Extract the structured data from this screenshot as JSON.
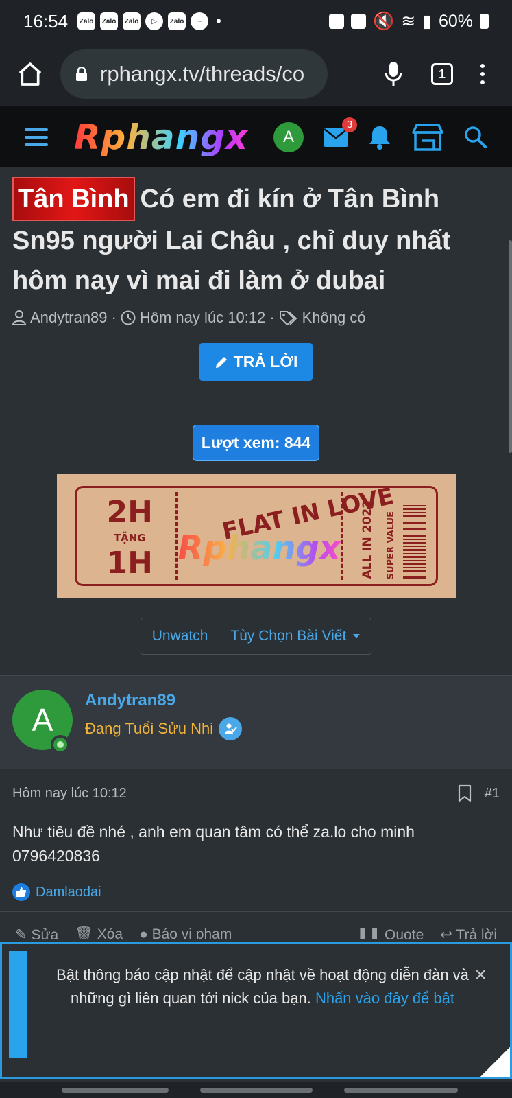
{
  "status_bar": {
    "time": "16:54",
    "notif_icons": [
      "Zalo",
      "Zalo",
      "Zalo",
      "",
      "Zalo",
      ""
    ],
    "battery": "60%"
  },
  "browser": {
    "url": "rphangx.tv/threads/co",
    "tab_count": "1"
  },
  "site_nav": {
    "logo": "Rphangx",
    "avatar_letter": "A",
    "inbox_badge": "3"
  },
  "thread": {
    "prefix": "Tân Bình",
    "title": "Có em đi kín ở Tân Bình Sn95 người Lai Châu , chỉ duy nhất hôm nay vì mai đi làm ở dubai",
    "author": "Andytran89",
    "date": "Hôm nay lúc 10:12",
    "tags": "Không có",
    "reply_label": "TRẢ LỜI",
    "views_label": "Lượt xem: 844"
  },
  "banner": {
    "left_top": "2H",
    "left_mid": "TẶNG",
    "left_bottom": "1H",
    "center_text": "FLAT IN LOVE",
    "watermark": "Rphangx",
    "side_text": "ALL IN 2023",
    "side_text2": "SUPER VALUE"
  },
  "thread_options": {
    "unwatch": "Unwatch",
    "post_options": "Tùy Chọn Bài Viết"
  },
  "post": {
    "avatar_letter": "A",
    "author": "Andytran89",
    "user_title": "Đang Tuổi Sửu Nhi",
    "date": "Hôm nay lúc 10:12",
    "number": "#1",
    "body": "Như tiêu đề nhé , anh em quan tâm có thể za.lo cho minh 0796420836",
    "liked_by": "Damlaodai",
    "actions_left": [
      "Sửa",
      "Xóa",
      "Báo vi phạm"
    ],
    "actions_right": [
      "Quote",
      "Trả lời"
    ]
  },
  "notice": {
    "text": "Bật thông báo cập nhật để cập nhật về hoạt động diễn đàn và những gì liên quan tới nick của bạn.",
    "link": "Nhấn vào đây để bật",
    "close": "×"
  }
}
